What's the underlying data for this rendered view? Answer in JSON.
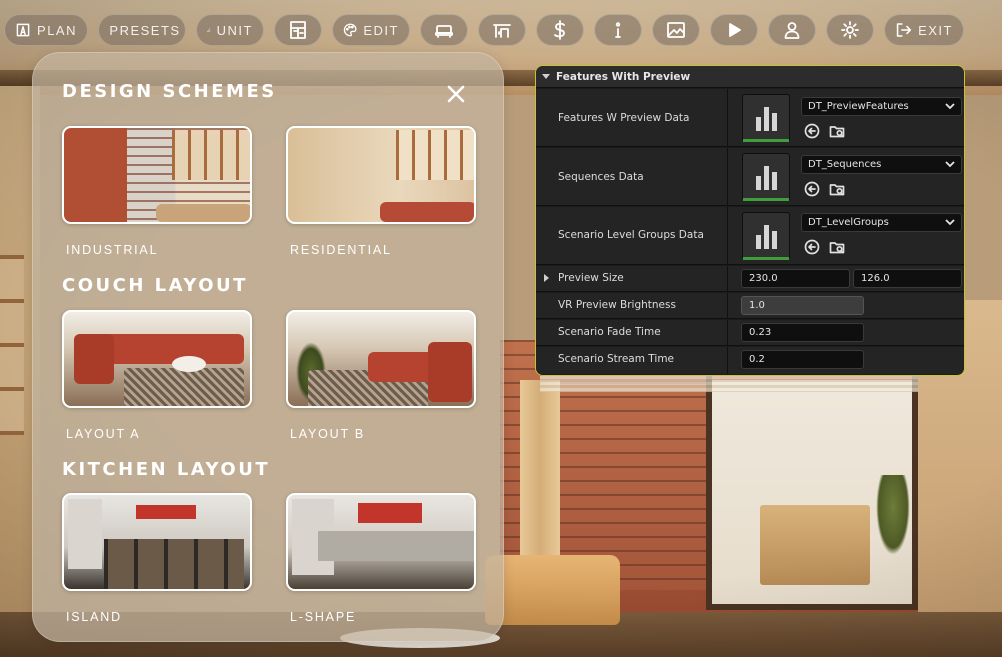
{
  "toolbar": {
    "plan": "PLAN",
    "presets": "PRESETS",
    "unit": "UNIT",
    "edit": "EDIT",
    "exit": "EXIT"
  },
  "schemes_panel": {
    "design_title": "DESIGN SCHEMES",
    "couch_title": "COUCH LAYOUT",
    "kitchen_title": "KITCHEN LAYOUT",
    "cards": {
      "industrial": "INDUSTRIAL",
      "residential": "RESIDENTIAL",
      "layout_a": "LAYOUT A",
      "layout_b": "LAYOUT B",
      "island": "ISLAND",
      "lshape": "L-SHAPE"
    }
  },
  "details": {
    "header": "Features With Preview",
    "rows": {
      "features": {
        "label": "Features W Preview Data",
        "asset": "DT_PreviewFeatures"
      },
      "sequences": {
        "label": "Sequences Data",
        "asset": "DT_Sequences"
      },
      "levels": {
        "label": "Scenario Level Groups Data",
        "asset": "DT_LevelGroups"
      },
      "preview_size": {
        "label": "Preview Size",
        "x": "230.0",
        "y": "126.0"
      },
      "brightness": {
        "label": "VR Preview Brightness",
        "value": "1.0"
      },
      "fade": {
        "label": "Scenario Fade Time",
        "value": "0.23"
      },
      "stream": {
        "label": "Scenario Stream Time",
        "value": "0.2"
      }
    }
  },
  "colors": {
    "panel_accent": "#c6c430",
    "asset_ok": "#3f9d3d"
  }
}
